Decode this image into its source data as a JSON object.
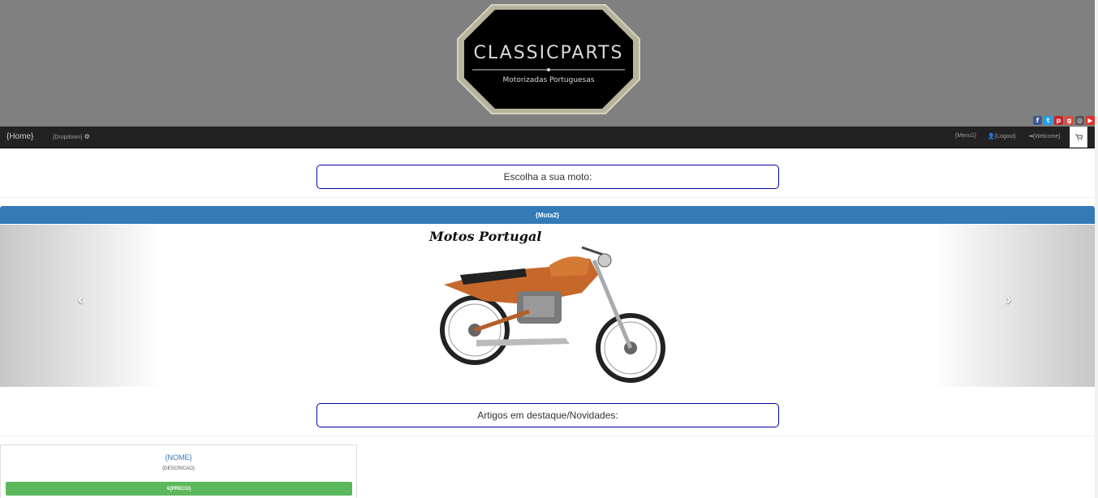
{
  "header": {
    "logo_title": "CLASSICPARTS",
    "logo_subtitle": "Motorizadas Portuguesas",
    "social_icons": [
      "facebook-icon",
      "twitter-icon",
      "pinterest-icon",
      "google-plus-icon",
      "instagram-icon",
      "youtube-icon"
    ]
  },
  "navbar": {
    "home": "{Home}",
    "dropdown": "{Dropdown}",
    "menu1": "{Menu1}",
    "logout": "{Logout}",
    "welcome": "{Welcome}"
  },
  "sections": {
    "choose_moto": "Escolha a sua moto:",
    "featured": "Artigos em destaque/Novidades:"
  },
  "carousel": {
    "heading": "{Mota2}",
    "prev": "‹",
    "next": "›",
    "image_logo_text": "Motos Portugal"
  },
  "product": {
    "name": "{NOME}",
    "description": "{DESCRICAO}",
    "price": "€{PRECO}"
  },
  "colors": {
    "banner": "#808080",
    "navbar": "#222222",
    "primary": "#337ab7",
    "success": "#5cb85c",
    "title_border": "#0000aa"
  }
}
